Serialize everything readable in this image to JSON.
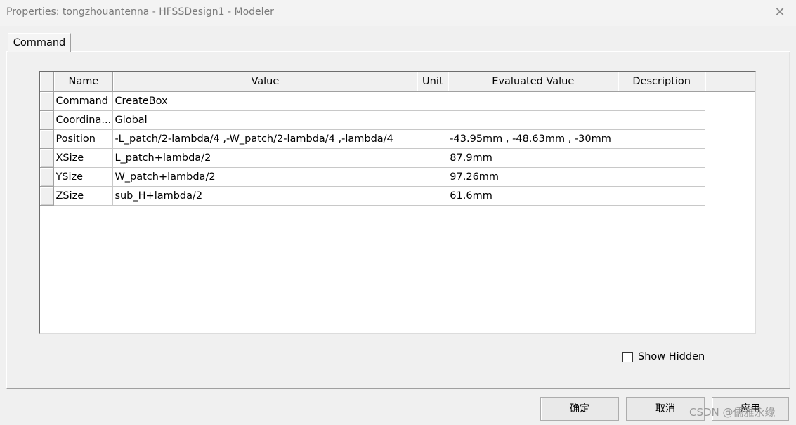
{
  "window": {
    "title": "Properties: tongzhouantenna - HFSSDesign1 - Modeler",
    "close_glyph": "✕"
  },
  "tabs": [
    {
      "label": "Command"
    }
  ],
  "grid": {
    "columns": [
      "Name",
      "Value",
      "Unit",
      "Evaluated Value",
      "Description"
    ],
    "rows": [
      {
        "name": "Command",
        "value": "CreateBox",
        "unit": "",
        "evaluated": "",
        "description": ""
      },
      {
        "name": "Coordina...",
        "value": "Global",
        "unit": "",
        "evaluated": "",
        "description": ""
      },
      {
        "name": "Position",
        "value": "-L_patch/2-lambda/4 ,-W_patch/2-lambda/4 ,-lambda/4",
        "unit": "",
        "evaluated": "-43.95mm , -48.63mm , -30mm",
        "description": ""
      },
      {
        "name": "XSize",
        "value": "L_patch+lambda/2",
        "unit": "",
        "evaluated": "87.9mm",
        "description": ""
      },
      {
        "name": "YSize",
        "value": "W_patch+lambda/2",
        "unit": "",
        "evaluated": "97.26mm",
        "description": ""
      },
      {
        "name": "ZSize",
        "value": "sub_H+lambda/2",
        "unit": "",
        "evaluated": "61.6mm",
        "description": ""
      }
    ]
  },
  "show_hidden": {
    "label": "Show Hidden",
    "checked": false
  },
  "buttons": {
    "ok": "确定",
    "cancel": "取消",
    "apply": "应用"
  },
  "watermark": "CSDN @儒雅永缘",
  "icons": {
    "close": "close-icon",
    "checkbox": "checkbox-icon"
  },
  "colors": {
    "background": "#f0f0f0",
    "title_text": "#7a7a7a",
    "grid_bg": "#ffffff"
  }
}
